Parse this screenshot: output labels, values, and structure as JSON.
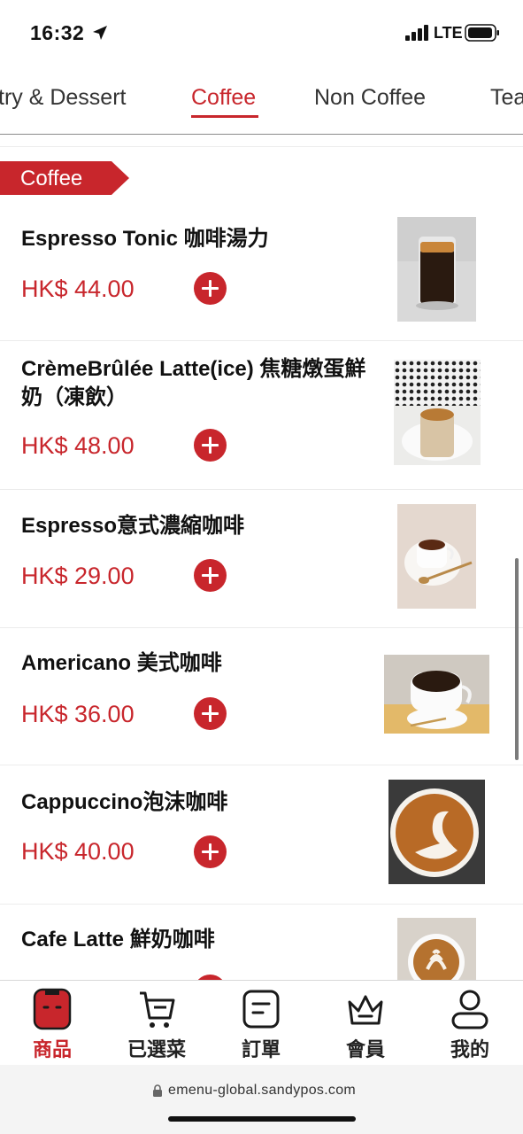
{
  "status_bar": {
    "time": "16:32",
    "network": "LTE"
  },
  "tabs": [
    {
      "label": "Pastry & Dessert",
      "visible_text": "try & Dessert",
      "active": false
    },
    {
      "label": "Coffee",
      "active": true
    },
    {
      "label": "Non Coffee",
      "active": false
    },
    {
      "label": "Tea",
      "visible_text": "Tea",
      "active": false
    }
  ],
  "section": {
    "title": "Coffee"
  },
  "items": [
    {
      "name": "Espresso Tonic 咖啡湯力",
      "price": "HK$ 44.00",
      "image": "espresso-tonic-photo"
    },
    {
      "name": "CrèmeBrûlée Latte(ice) 焦糖燉蛋鮮奶（凍飲）",
      "price": "HK$ 48.00",
      "image": "creme-brulee-latte-photo"
    },
    {
      "name": "Espresso意式濃縮咖啡",
      "price": "HK$ 29.00",
      "image": "espresso-photo"
    },
    {
      "name": "Americano 美式咖啡",
      "price": "HK$ 36.00",
      "image": "americano-photo"
    },
    {
      "name": "Cappuccino泡沫咖啡",
      "price": "HK$ 40.00",
      "image": "cappuccino-photo"
    },
    {
      "name": "Cafe Latte 鮮奶咖啡",
      "price": "",
      "image": "cafe-latte-photo"
    }
  ],
  "bottom_nav": [
    {
      "label": "商品",
      "icon": "goods-icon",
      "active": true
    },
    {
      "label": "已選菜",
      "icon": "cart-icon",
      "active": false
    },
    {
      "label": "訂單",
      "icon": "order-icon",
      "active": false
    },
    {
      "label": "會員",
      "icon": "crown-icon",
      "active": false
    },
    {
      "label": "我的",
      "icon": "user-icon",
      "active": false
    }
  ],
  "browser": {
    "url": "emenu-global.sandypos.com"
  },
  "colors": {
    "accent": "#c8262c",
    "text": "#111111",
    "divider": "#ececec"
  }
}
